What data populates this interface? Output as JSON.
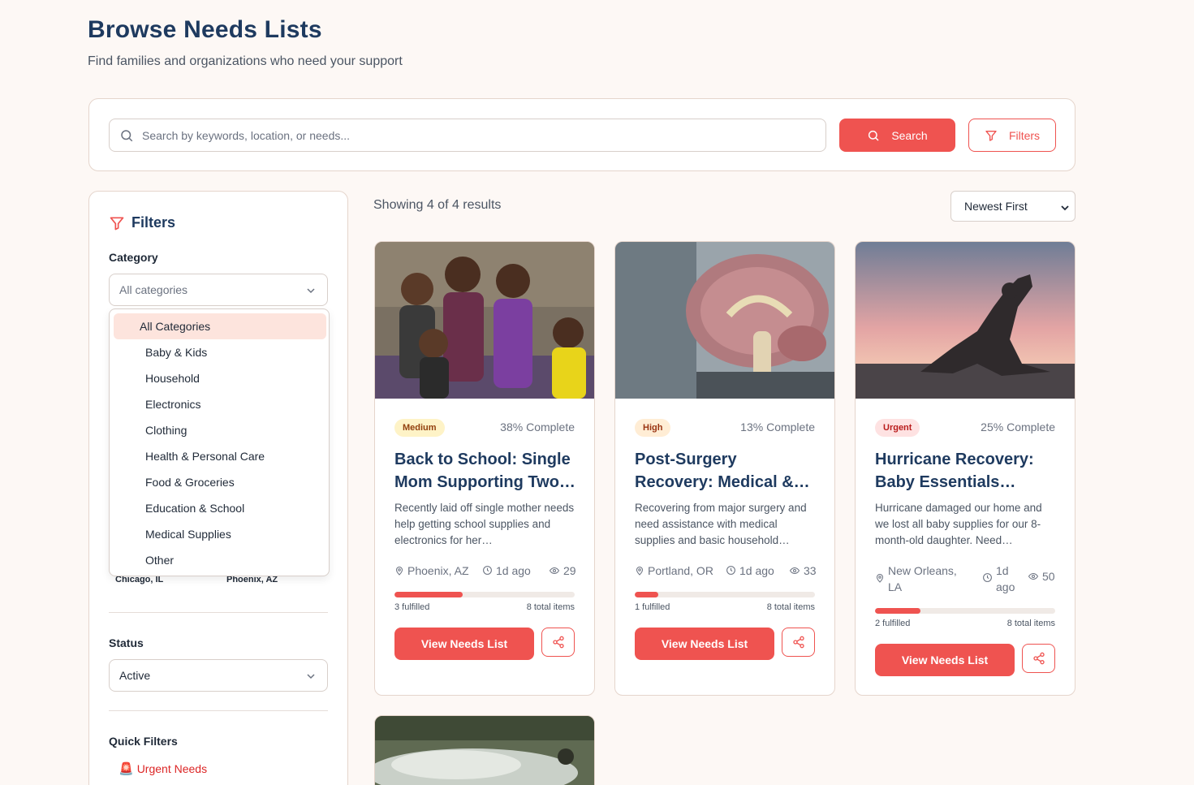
{
  "header": {
    "title": "Browse Needs Lists",
    "subtitle": "Find families and organizations who need your support"
  },
  "search": {
    "placeholder": "Search by keywords, location, or needs...",
    "value": "",
    "search_label": "Search",
    "filters_label": "Filters"
  },
  "sidebar": {
    "title": "Filters",
    "category_label": "Category",
    "category_selected": "All categories",
    "category_options": [
      "All Categories",
      "Baby & Kids",
      "Household",
      "Electronics",
      "Clothing",
      "Health & Personal Care",
      "Food & Groceries",
      "Education & School",
      "Medical Supplies",
      "Other"
    ],
    "locations": [
      "Chicago, IL",
      "Phoenix, AZ"
    ],
    "status_label": "Status",
    "status_selected": "Active",
    "quick_filters_label": "Quick Filters",
    "quick_filters": [
      {
        "icon": "siren-icon",
        "label": "Urgent Needs"
      }
    ]
  },
  "results": {
    "count_text": "Showing 4 of 4 results",
    "sort_selected": "Newest First"
  },
  "cards": [
    {
      "badge": "Medium",
      "complete": "38% Complete",
      "title": "Back to School: Single Mom Supporting Two…",
      "description": "Recently laid off single mother needs help getting school supplies and electronics for her…",
      "location": "Phoenix, AZ",
      "time": "1d ago",
      "views": "29",
      "progress": 0.38,
      "fulfilled": "3 fulfilled",
      "total": "8 total items",
      "button": "View Needs List"
    },
    {
      "badge": "High",
      "complete": "13% Complete",
      "title": "Post-Surgery Recovery: Medical &…",
      "description": "Recovering from major surgery and need assistance with medical supplies and basic household…",
      "location": "Portland, OR",
      "time": "1d ago",
      "views": "33",
      "progress": 0.13,
      "fulfilled": "1 fulfilled",
      "total": "8 total items",
      "button": "View Needs List"
    },
    {
      "badge": "Urgent",
      "complete": "25% Complete",
      "title": "Hurricane Recovery: Baby Essentials…",
      "description": "Hurricane damaged our home and we lost all baby supplies for our 8-month-old daughter. Need…",
      "location": "New Orleans, LA",
      "time": "1d ago",
      "views": "50",
      "progress": 0.25,
      "fulfilled": "2 fulfilled",
      "total": "8 total items",
      "button": "View Needs List"
    }
  ],
  "colors": {
    "accent": "#ef5350",
    "navy": "#1e3a5f",
    "background": "#fdf8f5",
    "badge_medium_bg": "#fef3c7",
    "badge_high_bg": "#ffedd5",
    "badge_urgent_bg": "#fee2e2"
  }
}
